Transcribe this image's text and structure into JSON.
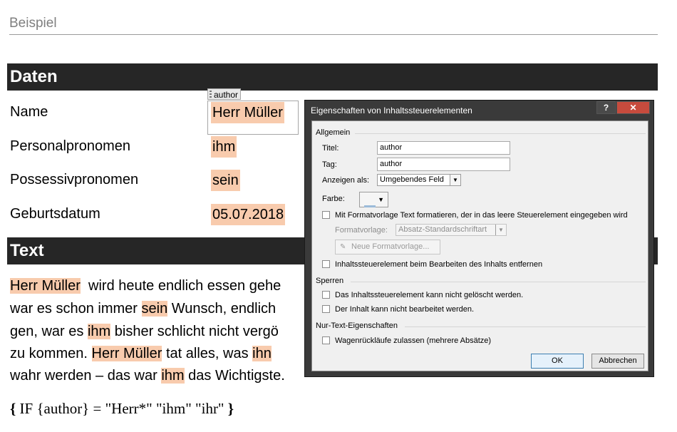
{
  "document": {
    "title": "Beispiel",
    "section_data": "Daten",
    "section_text": "Text",
    "fields": [
      {
        "label": "Name",
        "value": "Herr Müller"
      },
      {
        "label": "Personalpronomen",
        "value": "ihm"
      },
      {
        "label": "Possessivpronomen",
        "value": "sein"
      },
      {
        "label": "Geburtsdatum",
        "value": "05.07.2018"
      }
    ],
    "content_control_tag": "author",
    "paragraph": {
      "l1_hl1": "Herr Müller",
      "l1_t1": "wird heute endlich essen gehe",
      "l2_t1": "war es schon immer",
      "l2_hl1": "sein",
      "l2_t2": "Wunsch, endlich",
      "l3_t1": "gen, war es",
      "l3_hl1": "ihm",
      "l3_t2": "bisher schlicht nicht vergö",
      "l4_t1": "zu kommen.",
      "l4_hl1": "Herr Müller",
      "l4_t2": "tat alles, was",
      "l4_hl2": "ihn",
      "l5_t1": "wahr werden – das war",
      "l5_hl1": "ihm",
      "l5_t2": "das Wichtigste."
    },
    "formula": {
      "open": "{",
      "body": "IF {author} = \"Herr*\" \"ihm\" \"ihr\"",
      "close": "}"
    }
  },
  "dialog": {
    "title": "Eigenschaften von Inhaltssteuerelementen",
    "help_label": "?",
    "close_label": "✕",
    "group_general": "Allgemein",
    "title_label": "Titel:",
    "title_value": "author",
    "tag_label": "Tag:",
    "tag_value": "author",
    "show_as_label": "Anzeigen als:",
    "show_as_value": "Umgebendes Feld",
    "color_label": "Farbe:",
    "style_check_label": "Mit Formatvorlage Text formatieren, der in das leere Steuerelement eingegeben wird",
    "style_label": "Formatvorlage:",
    "style_value": "Absatz-Standardschriftart",
    "new_style_button": "Neue Formatvorlage...",
    "remove_check_label": "Inhaltssteuerelement beim Bearbeiten des Inhalts entfernen",
    "group_lock": "Sperren",
    "lock_delete_label": "Das Inhaltssteuerelement kann nicht gelöscht werden.",
    "lock_edit_label": "Der Inhalt kann nicht bearbeitet werden.",
    "group_plain": "Nur-Text-Eigenschaften",
    "multi_para_label": "Wagenrückläufe zulassen (mehrere Absätze)",
    "ok_button": "OK",
    "cancel_button": "Abbrechen"
  }
}
